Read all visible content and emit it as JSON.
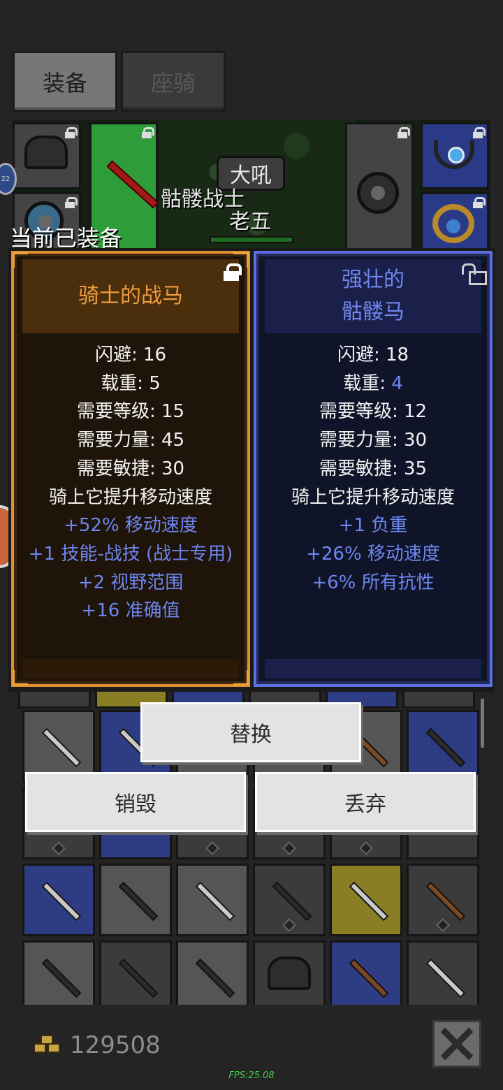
{
  "tabs": [
    {
      "label": "装备",
      "active": true
    },
    {
      "label": "座骑",
      "active": false
    }
  ],
  "scene": {
    "shout_text": "大吼",
    "character_name_1": "骷髅战士",
    "character_name_2": "老五",
    "side_badge": "22"
  },
  "equipped_label": "当前已装备",
  "current_item": {
    "name": "骑士的战马",
    "rarity_color": "#f09a3e",
    "locked": true,
    "stats": [
      {
        "text": "闪避: 16",
        "color": "white"
      },
      {
        "text": "载重: 5",
        "color": "white"
      },
      {
        "text": "需要等级: 15",
        "color": "white"
      },
      {
        "text": "需要力量: 45",
        "color": "white"
      },
      {
        "text": "需要敏捷: 30",
        "color": "white"
      },
      {
        "text": "骑上它提升移动速度",
        "color": "white"
      },
      {
        "text": "+52% 移动速度",
        "color": "blue"
      },
      {
        "text": "+1 技能-战技 (战士专用)",
        "color": "blue"
      },
      {
        "text": "+2 视野范围",
        "color": "blue"
      },
      {
        "text": "+16 准确值",
        "color": "blue"
      }
    ]
  },
  "compare_item": {
    "name_line1": "强壮的",
    "name_line2": "骷髅马",
    "rarity_color": "#6e86ef",
    "locked": false,
    "stats": [
      {
        "text": "闪避: 18",
        "color": "white"
      },
      {
        "text_prefix": "载重: ",
        "text_value": "4",
        "color": "white"
      },
      {
        "text": "需要等级: 12",
        "color": "white"
      },
      {
        "text": "需要力量: 30",
        "color": "white"
      },
      {
        "text": "需要敏捷: 35",
        "color": "white"
      },
      {
        "text": "骑上它提升移动速度",
        "color": "white"
      },
      {
        "text": "+1 负重",
        "color": "blue"
      },
      {
        "text": "+26% 移动速度",
        "color": "blue"
      },
      {
        "text": "+6% 所有抗性",
        "color": "blue"
      }
    ]
  },
  "actions": {
    "replace": "替换",
    "destroy": "销毁",
    "drop": "丢弃"
  },
  "gold": "129508",
  "fps": "FPS:25.08"
}
